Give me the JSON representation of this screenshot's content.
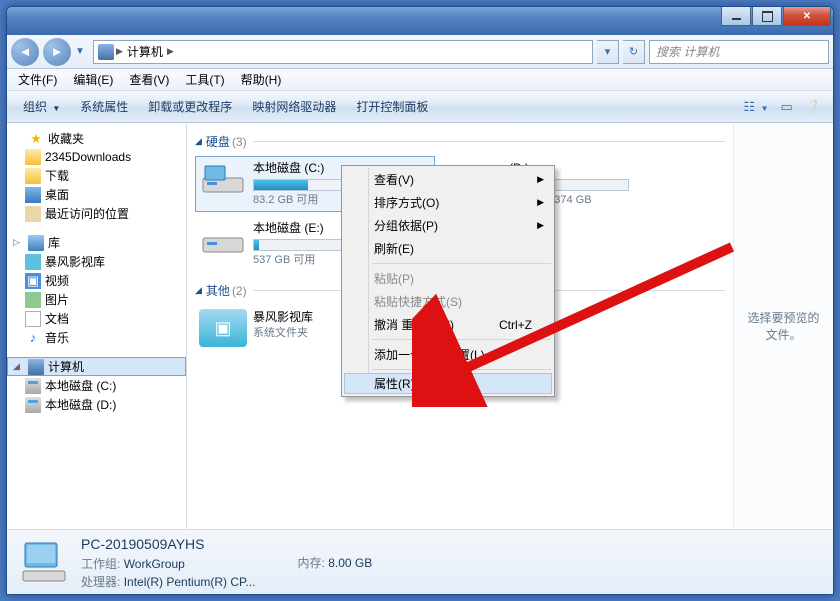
{
  "titlebar": {},
  "nav": {
    "breadcrumb_root": "计算机",
    "search_placeholder": "搜索 计算机"
  },
  "menubar": {
    "file": "文件(F)",
    "edit": "编辑(E)",
    "view": "查看(V)",
    "tools": "工具(T)",
    "help": "帮助(H)"
  },
  "toolbar": {
    "organize": "组织",
    "sys_props": "系统属性",
    "uninstall": "卸载或更改程序",
    "map_drive": "映射网络驱动器",
    "control_panel": "打开控制面板"
  },
  "tree": {
    "favorites": "收藏夹",
    "fav_items": [
      "2345Downloads",
      "下载",
      "桌面",
      "最近访问的位置"
    ],
    "library": "库",
    "lib_items": [
      "暴风影视库",
      "视频",
      "图片",
      "文档",
      "音乐"
    ],
    "computer": "计算机",
    "comp_items": [
      "本地磁盘 (C:)",
      "本地磁盘 (D:)"
    ]
  },
  "content": {
    "group_disk": "硬盘",
    "group_disk_count": "(3)",
    "group_other": "其他",
    "group_other_count": "(2)",
    "drives": [
      {
        "name": "本地磁盘 (C:)",
        "free": "83.2 GB 可用",
        "used_pct": 32
      },
      {
        "name": "本地磁盘 (E:)",
        "free": "537 GB 可用",
        "used_pct": 3
      }
    ],
    "drive_d": {
      "label_tail": "(D:)",
      "free_line": "可用 , 共 374 GB"
    },
    "other_item": {
      "name": "暴风影视库",
      "type": "系统文件夹"
    }
  },
  "context_menu": {
    "view": "查看(V)",
    "sort": "排序方式(O)",
    "group": "分组依据(P)",
    "refresh": "刷新(E)",
    "paste": "粘贴(P)",
    "paste_shortcut": "粘贴快捷方式(S)",
    "undo": "撤消 重命名(U)",
    "undo_sc": "Ctrl+Z",
    "add_loc": "添加一个网络位置(L)",
    "properties": "属性(R)"
  },
  "preview": {
    "text": "选择要预览的文件。"
  },
  "status": {
    "pc_name": "PC-20190509AYHS",
    "workgroup_lbl": "工作组:",
    "workgroup": "WorkGroup",
    "cpu_lbl": "处理器:",
    "cpu": "Intel(R) Pentium(R) CP...",
    "mem_lbl": "内存:",
    "mem": "8.00 GB"
  }
}
